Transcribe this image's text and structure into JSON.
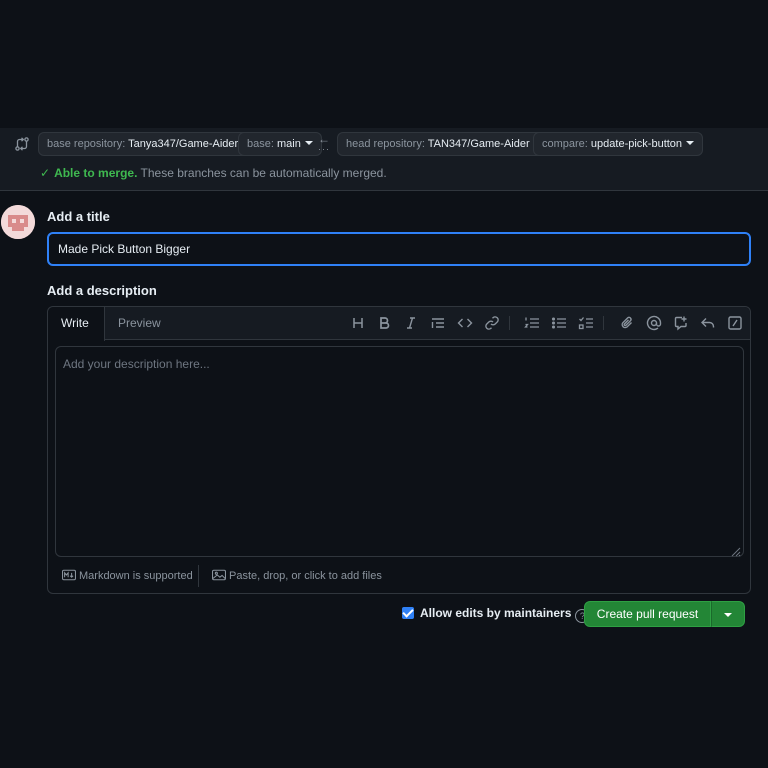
{
  "compare": {
    "base_repo": {
      "prefix": "base repository:",
      "value": "Tanya347/Game-Aider"
    },
    "base_branch": {
      "prefix": "base:",
      "value": "main"
    },
    "head_repo": {
      "prefix": "head repository:",
      "value": "TAN347/Game-Aider"
    },
    "compare_branch": {
      "prefix": "compare:",
      "value": "update-pick-button"
    },
    "merge_ok": "Able to merge.",
    "merge_detail": "These branches can be automatically merged."
  },
  "form": {
    "title_label": "Add a title",
    "title_value": "Made Pick Button Bigger",
    "description_label": "Add a description",
    "description_placeholder": "Add your description here..."
  },
  "editor": {
    "tabs": [
      "Write",
      "Preview"
    ],
    "markdown_hint": "Markdown is supported",
    "attach_hint": "Paste, drop, or click to add files"
  },
  "submit": {
    "allow_edits_label": "Allow edits by maintainers",
    "allow_edits_checked": true,
    "create_label": "Create pull request"
  },
  "colors": {
    "background": "#0d1117",
    "accent_blue": "#2f81f7",
    "success_green": "#3fb950",
    "button_green": "#238636"
  }
}
